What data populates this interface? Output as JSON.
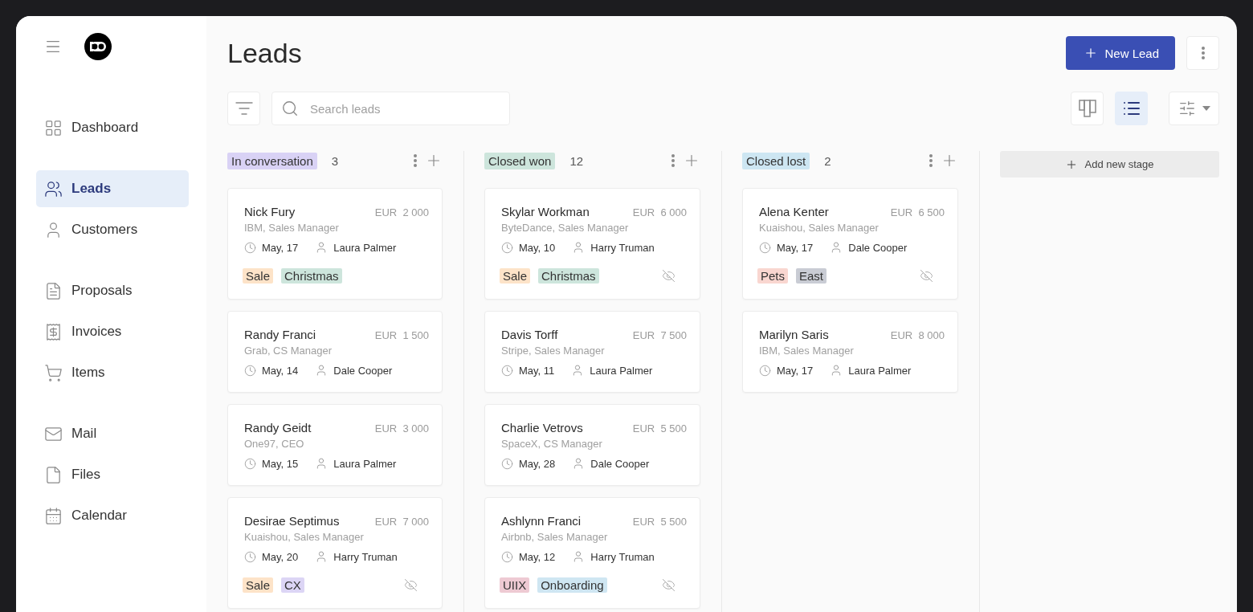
{
  "sidebar": {
    "groups": [
      [
        {
          "label": "Dashboard",
          "selected": false
        }
      ],
      [
        {
          "label": "Leads",
          "selected": true
        },
        {
          "label": "Customers",
          "selected": false
        }
      ],
      [
        {
          "label": "Proposals",
          "selected": false
        },
        {
          "label": "Invoices",
          "selected": false
        },
        {
          "label": "Items",
          "selected": false
        }
      ],
      [
        {
          "label": "Mail",
          "selected": false
        },
        {
          "label": "Files",
          "selected": false
        },
        {
          "label": "Calendar",
          "selected": false
        }
      ]
    ]
  },
  "header": {
    "title": "Leads",
    "new_button": "New Lead"
  },
  "search": {
    "placeholder": "Search leads"
  },
  "views": [
    {
      "kind": "board",
      "selected": false
    },
    {
      "kind": "list",
      "selected": true
    }
  ],
  "stages": [
    {
      "label": "In conversation",
      "color": "#d9d2f5",
      "count": "3",
      "cards": [
        {
          "name": "Nick Fury",
          "currency": "EUR",
          "amount": "2 000",
          "company": "IBM, Sales Manager",
          "date": "May, 17",
          "owner": "Laura Palmer",
          "hidden": false,
          "tags": [
            {
              "label": "Sale",
              "color": "#fde3c8"
            },
            {
              "label": "Christmas",
              "color": "#cde5dc"
            }
          ]
        },
        {
          "name": "Randy Franci",
          "currency": "EUR",
          "amount": "1 500",
          "company": "Grab, CS Manager",
          "date": "May, 14",
          "owner": "Dale Cooper",
          "hidden": false
        },
        {
          "name": "Randy Geidt",
          "currency": "EUR",
          "amount": "3 000",
          "company": "One97, CEO",
          "date": "May, 15",
          "owner": "Laura Palmer",
          "hidden": false
        },
        {
          "name": "Desirae Septimus",
          "currency": "EUR",
          "amount": "7 000",
          "company": "Kuaishou, Sales Manager",
          "date": "May, 20",
          "owner": "Harry Truman",
          "hidden": true,
          "tags": [
            {
              "label": "Sale",
              "color": "#fde3c8"
            },
            {
              "label": "CX",
              "color": "#dcd5f5"
            }
          ]
        }
      ]
    },
    {
      "label": "Closed won",
      "color": "#cde5dc",
      "count": "12",
      "cards": [
        {
          "name": "Skylar Workman",
          "currency": "EUR",
          "amount": "6 000",
          "company": "ByteDance, Sales Manager",
          "date": "May, 10",
          "owner": "Harry Truman",
          "hidden": true,
          "tags": [
            {
              "label": "Sale",
              "color": "#fde3c8"
            },
            {
              "label": "Christmas",
              "color": "#cde5dc"
            }
          ]
        },
        {
          "name": "Davis Torff",
          "currency": "EUR",
          "amount": "7 500",
          "company": "Stripe, Sales Manager",
          "date": "May, 11",
          "owner": "Laura Palmer",
          "hidden": false
        },
        {
          "name": "Charlie Vetrovs",
          "currency": "EUR",
          "amount": "5 500",
          "company": "SpaceX, CS Manager",
          "date": "May, 28",
          "owner": "Dale Cooper",
          "hidden": false
        },
        {
          "name": "Ashlynn Franci",
          "currency": "EUR",
          "amount": "5 500",
          "company": "Airbnb, Sales Manager",
          "date": "May, 12",
          "owner": "Harry Truman",
          "hidden": true,
          "tags": [
            {
              "label": "UIIX",
              "color": "#eecad3"
            },
            {
              "label": "Onboarding",
              "color": "#cfe6f2"
            }
          ]
        }
      ]
    },
    {
      "label": "Closed lost",
      "color": "#cde6f2",
      "count": "2",
      "cards": [
        {
          "name": "Alena Kenter",
          "currency": "EUR",
          "amount": "6 500",
          "company": "Kuaishou, Sales Manager",
          "date": "May, 17",
          "owner": "Dale Cooper",
          "hidden": true,
          "tags": [
            {
              "label": "Pets",
              "color": "#f9d6d0"
            },
            {
              "label": "East",
              "color": "#c9ccd4"
            }
          ]
        },
        {
          "name": "Marilyn Saris",
          "currency": "EUR",
          "amount": "8 000",
          "company": "IBM, Sales Manager",
          "date": "May, 17",
          "owner": "Laura Palmer",
          "hidden": false
        }
      ]
    }
  ],
  "add_stage": "Add new stage"
}
